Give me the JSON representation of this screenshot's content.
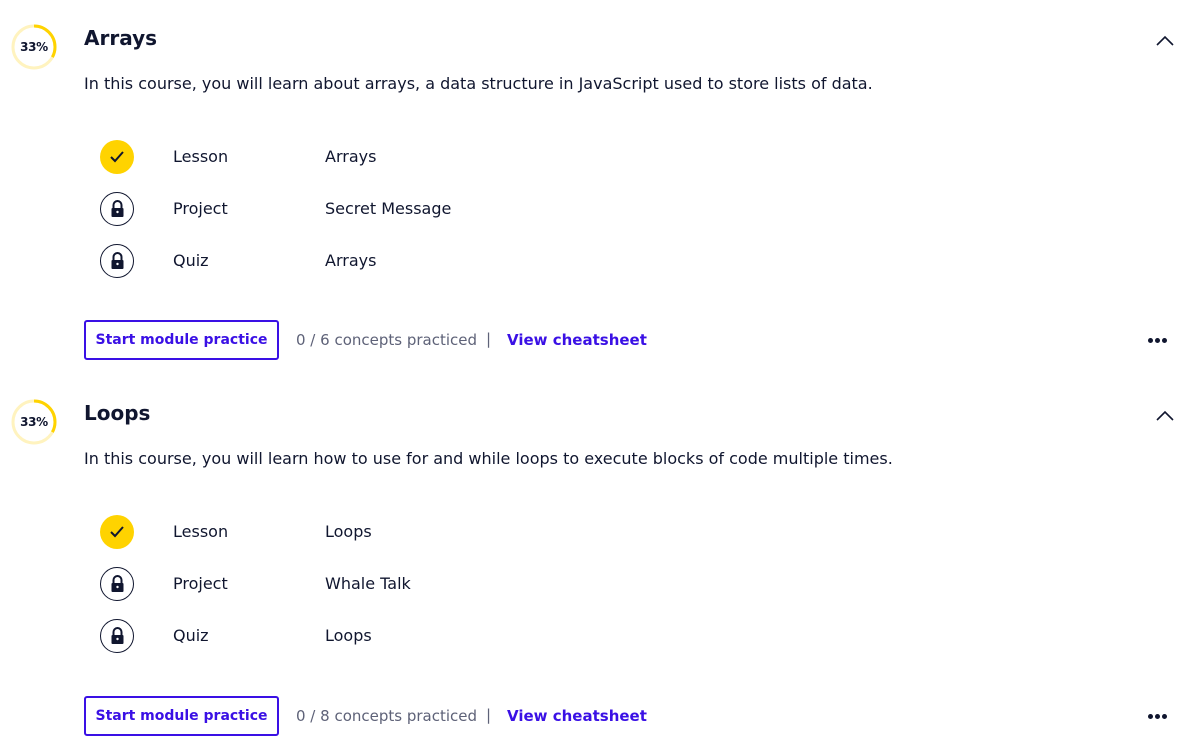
{
  "colors": {
    "text": "#10162f",
    "accent": "#3a10e5",
    "progress": "#ffd300",
    "progress_track": "#fff3bf",
    "muted": "#5e6278"
  },
  "modules": [
    {
      "progress": 0.33,
      "progress_label": "33%",
      "title": "Arrays",
      "description": "In this course, you will learn about arrays, a data structure in JavaScript used to store lists of data.",
      "items": [
        {
          "status": "complete",
          "icon": "check-icon",
          "type": "Lesson",
          "name": "Arrays"
        },
        {
          "status": "locked",
          "icon": "lock-icon",
          "type": "Project",
          "name": "Secret Message"
        },
        {
          "status": "locked",
          "icon": "lock-icon",
          "type": "Quiz",
          "name": "Arrays"
        }
      ],
      "practice_label": "Start module practice",
      "concepts_text": "0 / 6 concepts practiced",
      "separator": "|",
      "cheatsheet_label": "View cheatsheet"
    },
    {
      "progress": 0.33,
      "progress_label": "33%",
      "title": "Loops",
      "description": "In this course, you will learn how to use for and while loops to execute blocks of code multiple times.",
      "items": [
        {
          "status": "complete",
          "icon": "check-icon",
          "type": "Lesson",
          "name": "Loops"
        },
        {
          "status": "locked",
          "icon": "lock-icon",
          "type": "Project",
          "name": "Whale Talk"
        },
        {
          "status": "locked",
          "icon": "lock-icon",
          "type": "Quiz",
          "name": "Loops"
        }
      ],
      "practice_label": "Start module practice",
      "concepts_text": "0 / 8 concepts practiced",
      "separator": "|",
      "cheatsheet_label": "View cheatsheet"
    }
  ]
}
